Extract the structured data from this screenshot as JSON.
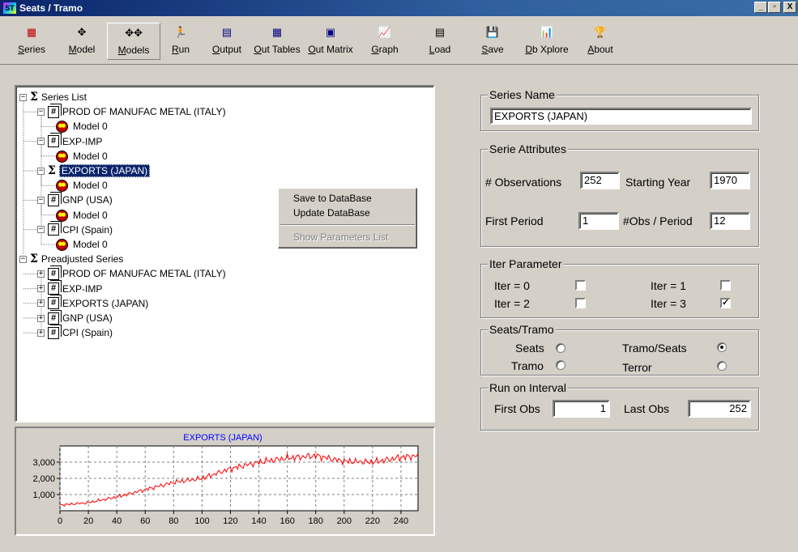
{
  "window": {
    "title": "Seats / Tramo",
    "icon_text": "ST"
  },
  "toolbar": [
    {
      "label": "Series",
      "icon": "series-icon",
      "glyph": "▦",
      "color": "#c00000",
      "w": 62
    },
    {
      "label": "Model",
      "icon": "model-icon",
      "glyph": "✥",
      "color": "#000000",
      "w": 62
    },
    {
      "label": "Models",
      "icon": "models-icon",
      "glyph": "✥✥",
      "color": "#000000",
      "w": 66,
      "pressed": true
    },
    {
      "label": "Run",
      "icon": "run-icon",
      "glyph": "🏃",
      "color": "#008000",
      "w": 50
    },
    {
      "label": "Output",
      "icon": "output-icon",
      "glyph": "▤",
      "color": "#000080",
      "w": 64
    },
    {
      "label": "Out Tables",
      "icon": "out-tables-icon",
      "glyph": "▦",
      "color": "#000080",
      "w": 60
    },
    {
      "label": "Out Matrix",
      "icon": "out-matrix-icon",
      "glyph": "▣",
      "color": "#000080",
      "w": 72
    },
    {
      "label": "Graph",
      "icon": "graph-icon",
      "glyph": "📈",
      "color": "#000080",
      "w": 62
    },
    {
      "label": "Load",
      "icon": "load-icon",
      "glyph": "▤",
      "color": "#000000",
      "w": 74
    },
    {
      "label": "Save",
      "icon": "save-icon",
      "glyph": "💾",
      "color": "#000000",
      "w": 56
    },
    {
      "label": "Db Xplore",
      "icon": "db-xplore-icon",
      "glyph": "📊",
      "color": "#008000",
      "w": 78
    },
    {
      "label": "About",
      "icon": "about-icon",
      "glyph": "🏆",
      "color": "#808000",
      "w": 54
    }
  ],
  "tree": {
    "rows": [
      {
        "type": "root",
        "label": "Series List",
        "expander": "−"
      },
      {
        "type": "series",
        "label": "PROD OF MANUFAC METAL (ITALY)",
        "expander": "−"
      },
      {
        "type": "model",
        "label": "Model 0"
      },
      {
        "type": "series",
        "label": "EXP-IMP",
        "expander": "−"
      },
      {
        "type": "model",
        "label": "Model 0"
      },
      {
        "type": "series-sigma",
        "label": "EXPORTS (JAPAN)",
        "expander": "−",
        "selected": true
      },
      {
        "type": "model",
        "label": "Model 0"
      },
      {
        "type": "series",
        "label": "GNP (USA)",
        "expander": "−"
      },
      {
        "type": "model",
        "label": "Model 0"
      },
      {
        "type": "series",
        "label": "CPI (Spain)",
        "expander": "−"
      },
      {
        "type": "model",
        "label": "Model 0"
      },
      {
        "type": "root",
        "label": "Preadjusted Series",
        "expander": "−"
      },
      {
        "type": "series",
        "label": "PROD OF MANUFAC METAL (ITALY)",
        "expander": "+"
      },
      {
        "type": "series",
        "label": "EXP-IMP",
        "expander": "+"
      },
      {
        "type": "series",
        "label": "EXPORTS (JAPAN)",
        "expander": "+"
      },
      {
        "type": "series",
        "label": "GNP (USA)",
        "expander": "+"
      },
      {
        "type": "series",
        "label": "CPI (Spain)",
        "expander": "+"
      }
    ]
  },
  "context_menu": {
    "items": [
      {
        "label": "Save to DataBase",
        "enabled": true
      },
      {
        "label": "Update DataBase",
        "enabled": true
      },
      {
        "label": "Show Parameters List",
        "enabled": false
      }
    ]
  },
  "chart_data": {
    "type": "line",
    "title": "EXPORTS (JAPAN)",
    "title_color": "#0000ff",
    "series_color": "#ff0000",
    "xlim": [
      0,
      252
    ],
    "ylim": [
      0,
      4000
    ],
    "xticks": [
      0,
      20,
      40,
      60,
      80,
      100,
      120,
      140,
      160,
      180,
      200,
      220,
      240
    ],
    "xtick_labels": [
      "0",
      "20",
      "40",
      "60",
      "80",
      "100",
      "120",
      "140",
      "160",
      "180",
      "200",
      "220",
      "240"
    ],
    "yticks": [
      1000,
      2000,
      3000
    ],
    "ytick_labels": [
      "1,000",
      "2,000",
      "3,000"
    ],
    "grid": true,
    "trend_x": [
      0,
      20,
      40,
      60,
      80,
      100,
      120,
      140,
      160,
      180,
      200,
      220,
      240,
      252
    ],
    "trend_y": [
      350,
      500,
      850,
      1300,
      1750,
      2000,
      2600,
      3000,
      3250,
      3400,
      3050,
      3000,
      3300,
      3400
    ]
  },
  "series_name": {
    "title": "Series Name",
    "value": "EXPORTS (JAPAN)"
  },
  "serie_attributes": {
    "title": "Serie Attributes",
    "observations_label": "# Observations",
    "observations": "252",
    "starting_year_label": "Starting Year",
    "starting_year": "1970",
    "first_period_label": "First Period",
    "first_period": "1",
    "obs_per_period_label": "#Obs / Period",
    "obs_per_period": "12"
  },
  "iter_parameter": {
    "title": "Iter Parameter",
    "items": [
      {
        "label": "Iter = 0",
        "checked": false
      },
      {
        "label": "Iter = 1",
        "checked": false
      },
      {
        "label": "Iter = 2",
        "checked": false
      },
      {
        "label": "Iter = 3",
        "checked": true
      }
    ],
    "check_mark": "✓"
  },
  "seats_tramo": {
    "title": "Seats/Tramo",
    "options": [
      {
        "label": "Seats",
        "selected": false
      },
      {
        "label": "Tramo/Seats",
        "selected": true
      },
      {
        "label": "Tramo",
        "selected": false
      },
      {
        "label": "Terror",
        "selected": false
      }
    ]
  },
  "run_interval": {
    "title": "Run on Interval",
    "first_obs_label": "First Obs",
    "first_obs": "1",
    "last_obs_label": "Last Obs",
    "last_obs": "252"
  },
  "window_buttons": {
    "minimize": "_",
    "maximize": "▫",
    "close": "X"
  }
}
